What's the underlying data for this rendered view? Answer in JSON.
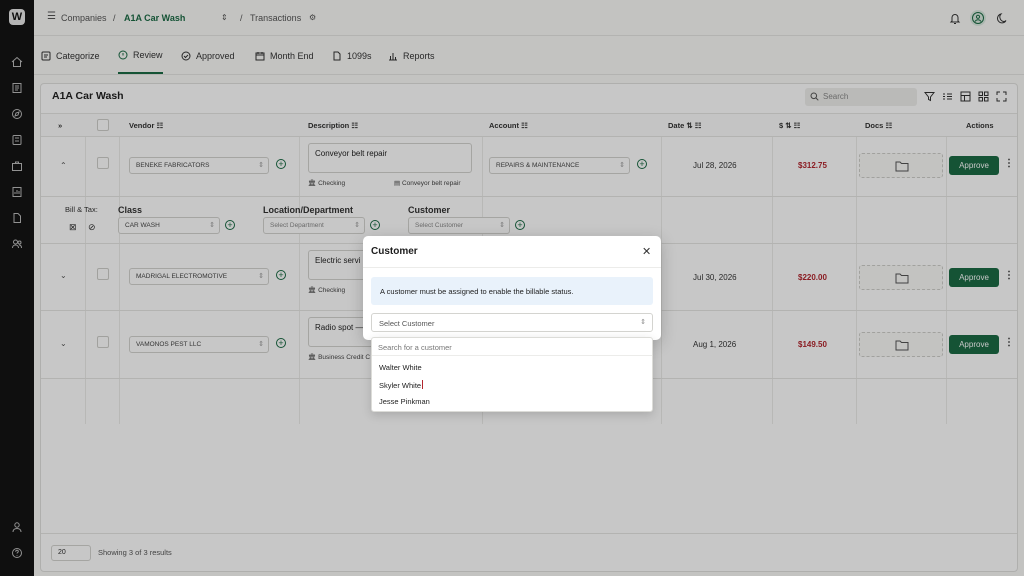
{
  "breadcrumb": {
    "root": "Companies",
    "sep": "/",
    "company": "A1A Car Wash",
    "page": "Transactions"
  },
  "tabs": [
    {
      "label": "Categorize",
      "icon": "categorize-icon"
    },
    {
      "label": "Review",
      "icon": "review-icon",
      "active": true
    },
    {
      "label": "Approved",
      "icon": "approved-icon"
    },
    {
      "label": "Month End",
      "icon": "calendar-icon"
    },
    {
      "label": "1099s",
      "icon": "document-icon"
    },
    {
      "label": "Reports",
      "icon": "reports-icon"
    }
  ],
  "panel": {
    "title": "A1A Car Wash",
    "search_placeholder": "Search"
  },
  "columns": {
    "vendor": "Vendor",
    "description": "Description",
    "account": "Account",
    "date": "Date",
    "amount": "$",
    "docs": "Docs",
    "actions": "Actions",
    "sort_icon": "⇅",
    "filter_icon": "☷"
  },
  "rows": [
    {
      "vendor": "BENEKE FABRICATORS",
      "description": "Conveyor belt repair",
      "payment": "Checking",
      "attachment": "Conveyor belt repair",
      "account": "REPAIRS & MAINTENANCE",
      "date": "Jul 28, 2026",
      "amount": "$312.75",
      "approve": "Approve"
    },
    {
      "vendor": "MADRIGAL ELECTROMOTIVE",
      "description": "Electric servi",
      "payment": "Checking",
      "date": "Jul 30, 2026",
      "amount": "$220.00",
      "approve": "Approve"
    },
    {
      "vendor": "VAMONOS PEST LLC",
      "description": "Radio spot —",
      "payment": "Business Credit C",
      "date": "Aug 1, 2026",
      "amount": "$149.50",
      "approve": "Approve"
    }
  ],
  "bill_tax": {
    "label": "Bill & Tax:",
    "class_label": "Class",
    "class_value": "CAR WASH",
    "location_label": "Location/Department",
    "location_placeholder": "Select Department",
    "customer_label": "Customer",
    "customer_placeholder": "Select Customer"
  },
  "footer": {
    "page_size": "20",
    "showing": "Showing 3 of 3 results"
  },
  "modal": {
    "title": "Customer",
    "close": "✕",
    "info": "A customer must be assigned to enable the billable status.",
    "select_placeholder": "Select Customer",
    "search_placeholder": "Search for a customer",
    "options": [
      "Walter White",
      "Skyler White",
      "Jesse Pinkman"
    ]
  },
  "colors": {
    "accent": "#1b6b45",
    "amount": "#b3262e",
    "info_bg": "#e9f2fb"
  }
}
